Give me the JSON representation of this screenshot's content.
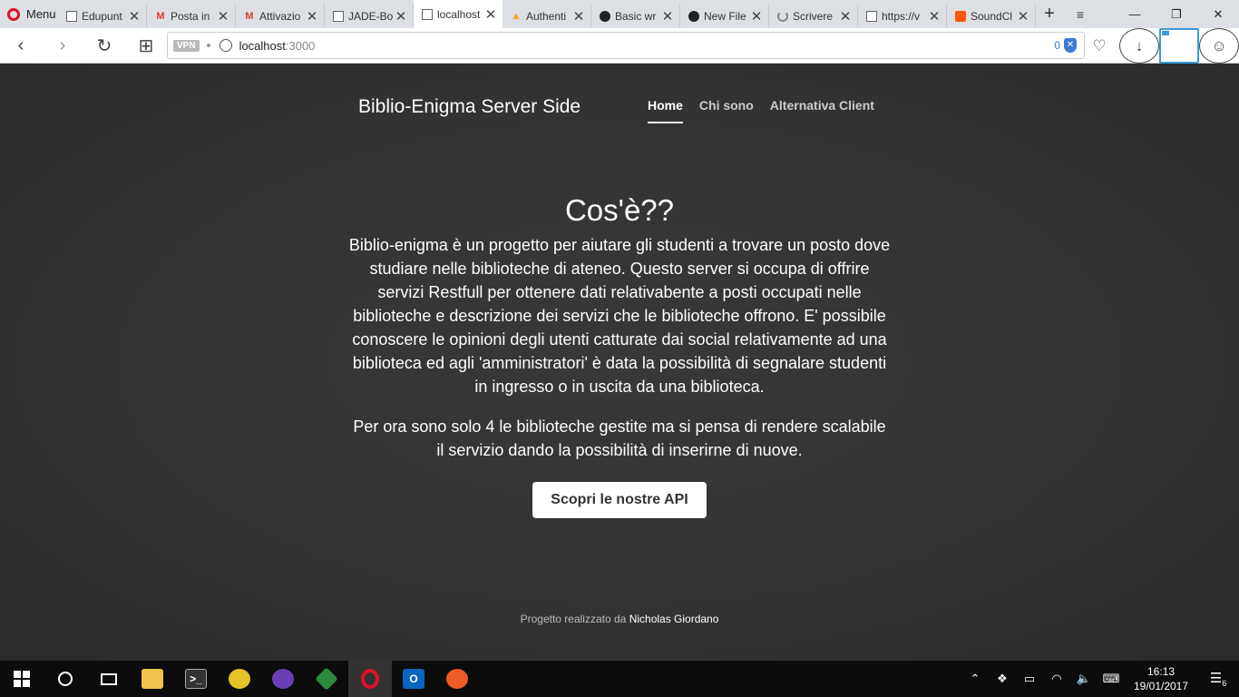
{
  "browser": {
    "menu_label": "Menu",
    "tabs": [
      {
        "title": "Edupunt",
        "icon": "document-icon"
      },
      {
        "title": "Posta in",
        "icon": "gmail-icon"
      },
      {
        "title": "Attivazio",
        "icon": "gmail-icon"
      },
      {
        "title": "JADE-Bo",
        "icon": "document-icon"
      },
      {
        "title": "localhost",
        "icon": "document-icon",
        "active": true
      },
      {
        "title": "Authenti",
        "icon": "firebase-icon"
      },
      {
        "title": "Basic wr",
        "icon": "github-icon"
      },
      {
        "title": "New File",
        "icon": "github-icon"
      },
      {
        "title": "Scrivere",
        "icon": "loading-icon"
      },
      {
        "title": "https://v",
        "icon": "document-icon"
      },
      {
        "title": "SoundCl",
        "icon": "soundcloud-icon"
      }
    ],
    "address": {
      "vpn_label": "VPN",
      "host": "localhost",
      "port": ":3000",
      "blocked_count": "0"
    }
  },
  "site": {
    "brand": "Biblio-Enigma Server Side",
    "nav": [
      {
        "label": "Home",
        "active": true
      },
      {
        "label": "Chi sono"
      },
      {
        "label": "Alternativa Client"
      }
    ],
    "hero": {
      "title": "Cos'è??",
      "paragraph_1": "Biblio-enigma è un progetto per aiutare gli studenti a trovare un posto dove studiare nelle biblioteche di ateneo. Questo server si occupa di offrire servizi Restfull per ottenere dati relativabente a posti occupati nelle biblioteche e descrizione dei servizi che le biblioteche offrono. E' possibile conoscere le opinioni degli utenti catturate dai social relativamente ad una biblioteca ed agli 'amministratori' è data la possibilità di segnalare studenti in ingresso o in uscita da una biblioteca.",
      "paragraph_2": "Per ora sono solo 4 le biblioteche gestite ma si pensa di rendere scalabile il servizio dando la possibilità di inserirne di nuove.",
      "cta_label": "Scopri le nostre API"
    },
    "footer": {
      "prefix": "Progetto realizzato da",
      "author": "Nicholas Giordano"
    }
  },
  "taskbar": {
    "time": "16:13",
    "date": "19/01/2017",
    "notification_count": "6"
  }
}
